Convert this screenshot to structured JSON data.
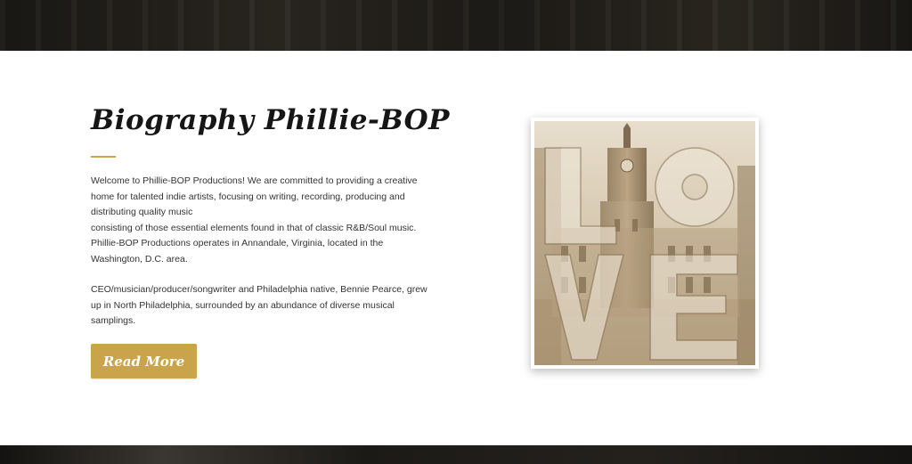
{
  "section": {
    "title": "Biography Phillie-BOP",
    "paragraph1_lines": [
      "Welcome to Phillie-BOP Productions! We are committed to providing a creative",
      "home for talented indie artists, focusing on writing, recording, producing and",
      "distributing quality music",
      "consisting of those essential elements found in that of classic R&B/Soul music.",
      "Phillie-BOP Productions operates in Annandale, Virginia, located in the",
      "Washington, D.C. area."
    ],
    "paragraph2_lines": [
      "CEO/musician/producer/songwriter and Philadelphia native, Bennie Pearce, grew",
      "up in North Philadelphia, surrounded by an abundance of diverse musical",
      "samplings."
    ],
    "read_more_label": "Read More"
  },
  "colors": {
    "accent": "#c9a44a",
    "text": "#333333",
    "title": "#161616",
    "band": "#1e1c18"
  },
  "image": {
    "icon": "love-sculpture-city-hall-photo"
  }
}
